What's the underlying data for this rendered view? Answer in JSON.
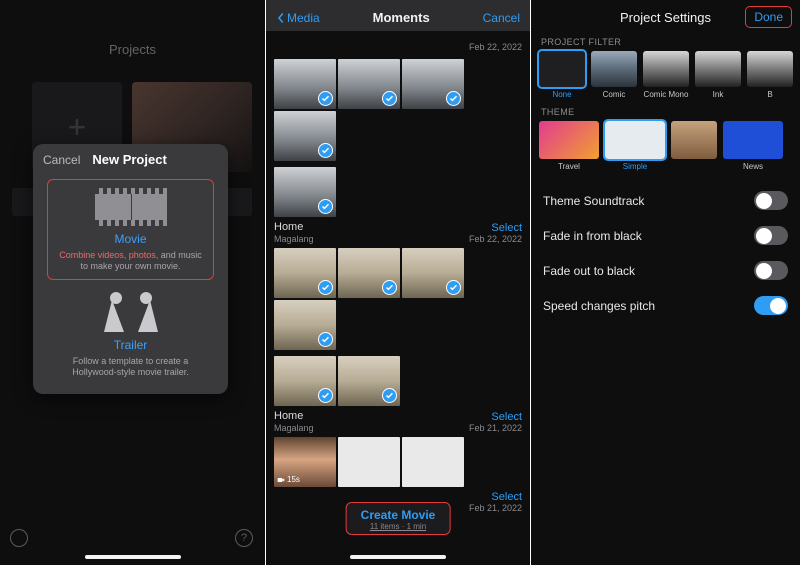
{
  "pane1": {
    "pageTitle": "Projects",
    "modal": {
      "cancel": "Cancel",
      "title": "New Project",
      "movie": {
        "label": "Movie",
        "desc_red": "Combine videos, photos,",
        "desc_rest": " and music to make your own movie."
      },
      "trailer": {
        "label": "Trailer",
        "desc": "Follow a template to create a Hollywood-style movie trailer."
      }
    }
  },
  "pane2": {
    "back": "Media",
    "title": "Moments",
    "cancel": "Cancel",
    "sections": [
      {
        "name": "",
        "sub": "",
        "date": "Feb 22, 2022",
        "select": "",
        "thumbs": 4
      },
      {
        "name": "Home",
        "sub": "Magalang",
        "date": "Feb 22, 2022",
        "select": "Select",
        "thumbs": 1
      },
      {
        "name": "",
        "sub": "",
        "date": "",
        "select": "",
        "thumbs": 4
      },
      {
        "name": "Home",
        "sub": "Magalang",
        "date": "Feb 21, 2022",
        "select": "Select",
        "thumbs": 2
      },
      {
        "name": "",
        "sub": "",
        "date": "",
        "select": "",
        "thumbs": 3
      },
      {
        "name": "",
        "sub": "",
        "date": "Feb 21, 2022",
        "select": "Select",
        "thumbs": 0
      }
    ],
    "videoDuration": "15s",
    "create": {
      "label": "Create Movie",
      "count": "11 items · 1 min"
    }
  },
  "pane3": {
    "title": "Project Settings",
    "done": "Done",
    "groupFilter": "PROJECT FILTER",
    "filters": [
      "None",
      "Comic",
      "Comic Mono",
      "Ink",
      "B"
    ],
    "groupTheme": "THEME",
    "themes": [
      "Travel",
      "Simple",
      "News"
    ],
    "rows": {
      "soundtrack": "Theme Soundtrack",
      "fadein": "Fade in from black",
      "fadeout": "Fade out to black",
      "speed": "Speed changes pitch"
    }
  }
}
